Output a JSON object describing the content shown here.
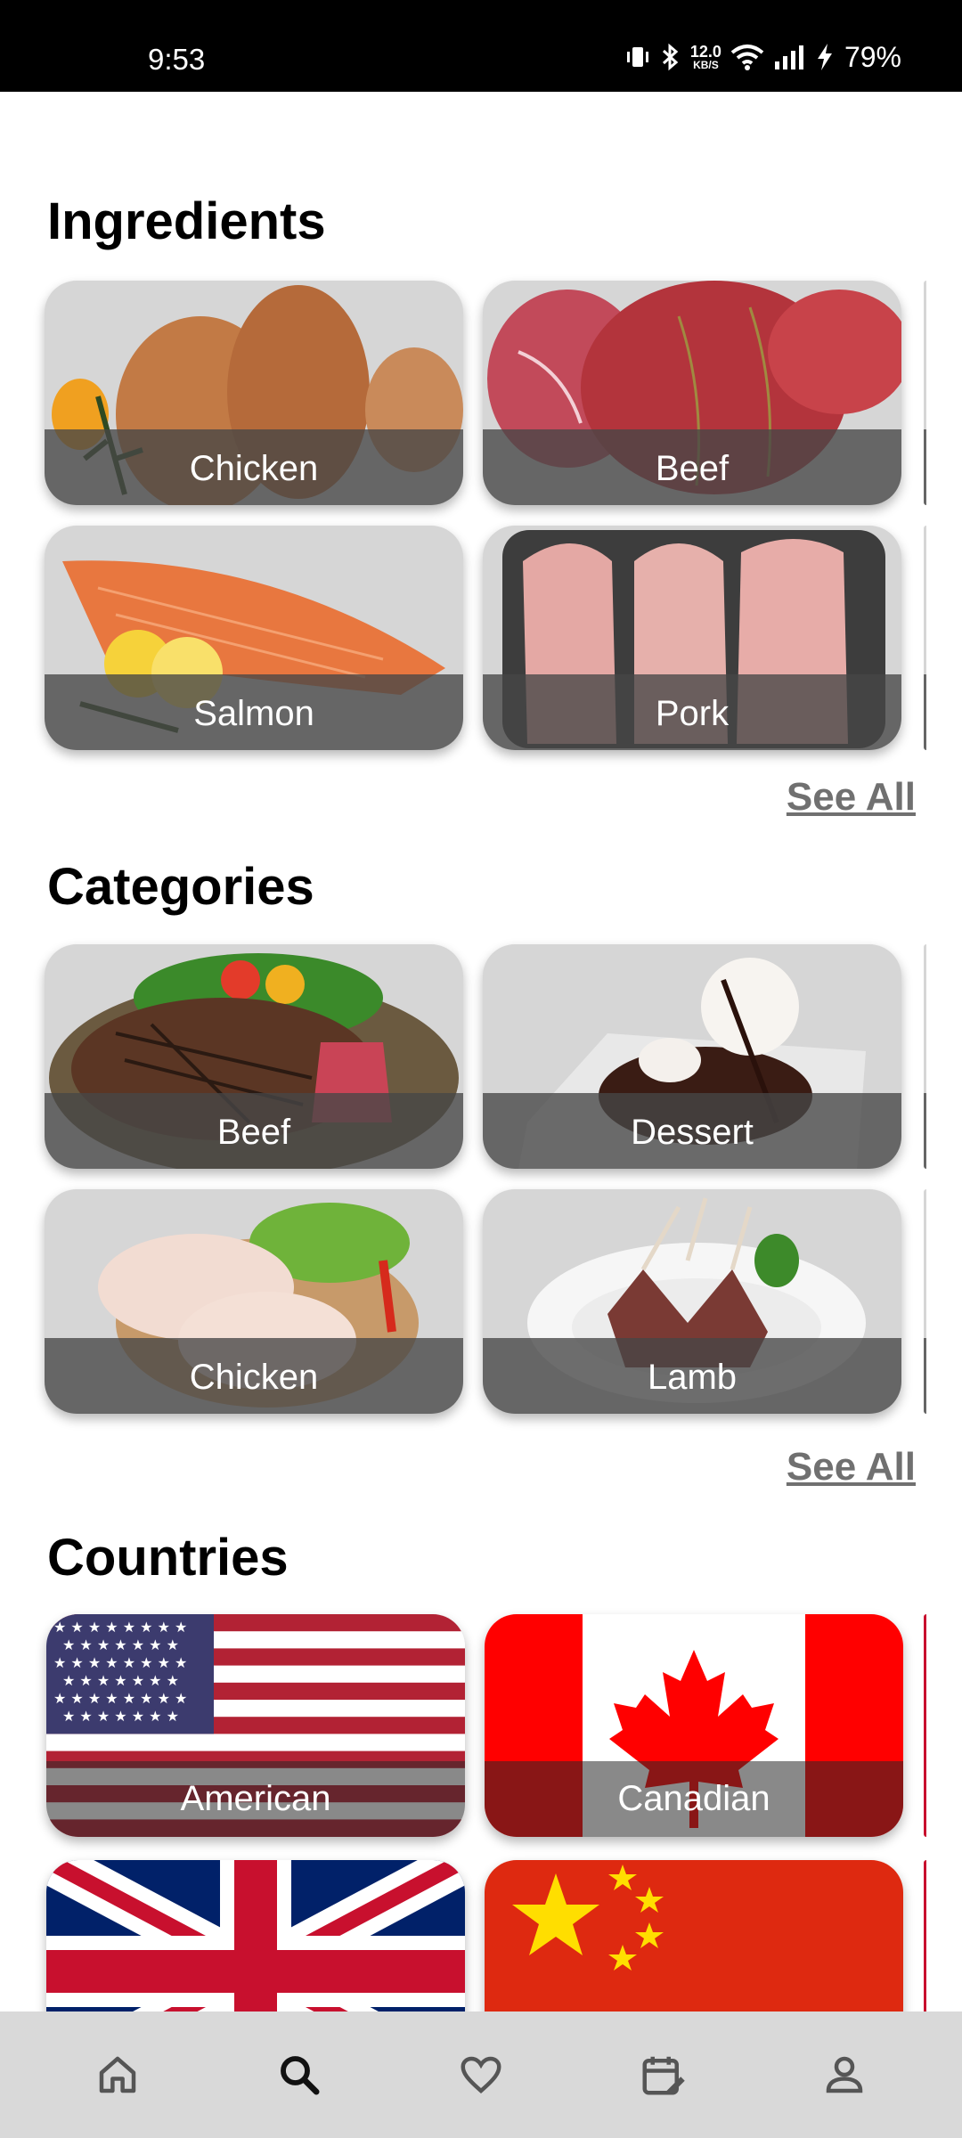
{
  "status_bar": {
    "time": "9:53",
    "net_speed_value": "12.0",
    "net_speed_unit": "KB/S",
    "battery": "79%",
    "icons": [
      "vibrate-icon",
      "bluetooth-icon",
      "wifi-icon",
      "signal-icon",
      "charging-icon"
    ]
  },
  "ingredients": {
    "title": "Ingredients",
    "see_all": "See All",
    "items": [
      {
        "label": "Chicken"
      },
      {
        "label": "Beef"
      },
      {
        "label": "Salmon"
      },
      {
        "label": "Pork"
      }
    ]
  },
  "categories": {
    "title": "Categories",
    "see_all": "See All",
    "items": [
      {
        "label": "Beef"
      },
      {
        "label": "Dessert"
      },
      {
        "label": "Chicken"
      },
      {
        "label": "Lamb"
      }
    ]
  },
  "countries": {
    "title": "Countries",
    "items": [
      {
        "label": "American"
      },
      {
        "label": "Canadian"
      },
      {
        "label": ""
      },
      {
        "label": ""
      }
    ]
  },
  "bottom_nav": {
    "items": [
      {
        "icon": "home-icon"
      },
      {
        "icon": "search-icon",
        "active": true
      },
      {
        "icon": "heart-icon"
      },
      {
        "icon": "calendar-edit-icon"
      },
      {
        "icon": "profile-icon"
      }
    ]
  },
  "colors": {
    "card_bg": "#d6d6d6",
    "label_overlay": "#464646",
    "see_all": "#707070",
    "nav_bg": "#d9d9d9"
  }
}
